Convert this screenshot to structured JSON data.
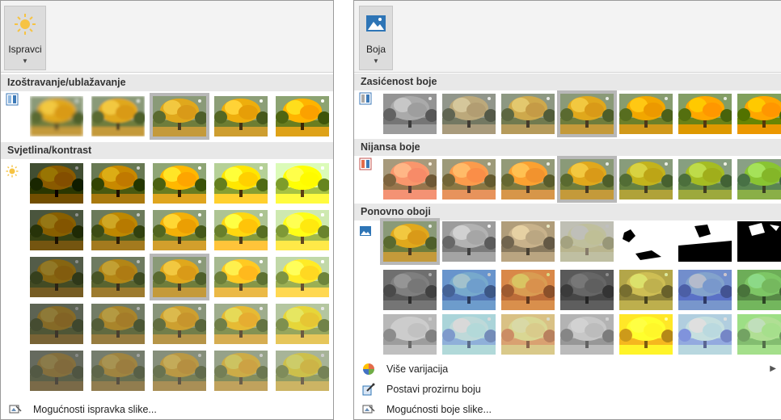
{
  "left_panel": {
    "ribbon_button": {
      "label": "Ispravci",
      "icon": "sun-icon"
    },
    "sections": [
      {
        "title": "Izoštravanje/ublažavanje",
        "icon": "sharpen-icon"
      },
      {
        "title": "Svjetlina/kontrast",
        "icon": "brightness-icon"
      }
    ],
    "footer": {
      "label": "Mogućnosti ispravka slike...",
      "icon": "picture-options-icon"
    }
  },
  "right_panel": {
    "ribbon_button": {
      "label": "Boja",
      "icon": "picture-color-icon"
    },
    "sections": [
      {
        "title": "Zasićenost boje",
        "icon": "saturation-icon"
      },
      {
        "title": "Nijansa boje",
        "icon": "tone-icon"
      },
      {
        "title": "Ponovno oboji",
        "icon": "recolor-icon"
      }
    ],
    "menu": [
      {
        "label": "Više varijacija",
        "icon": "palette-icon",
        "has_submenu": true
      },
      {
        "label": "Postavi prozirnu boju",
        "icon": "eyedropper-icon"
      },
      {
        "label": "Mogućnosti boje slike...",
        "icon": "picture-options-icon"
      }
    ]
  }
}
